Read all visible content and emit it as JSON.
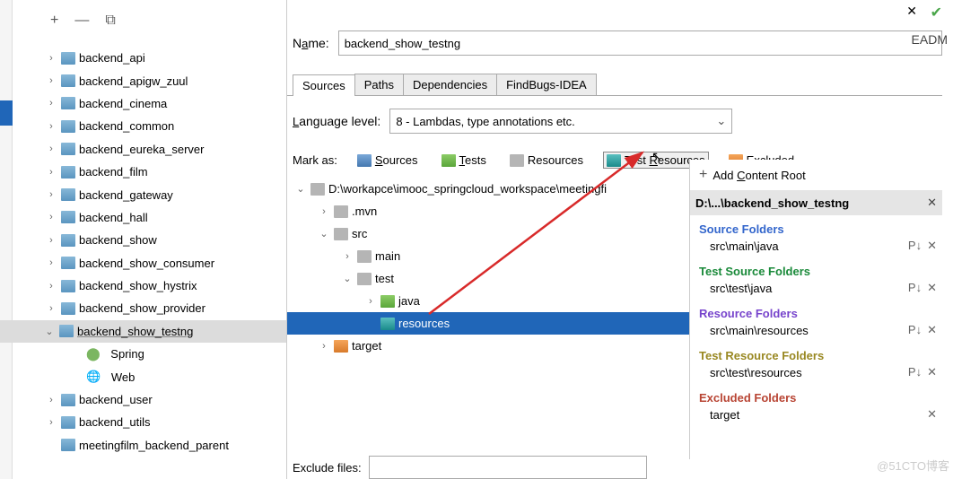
{
  "toolbar": {
    "add": "+",
    "remove": "—",
    "copy": "⧉"
  },
  "project_tree": [
    {
      "label": "backend_api"
    },
    {
      "label": "backend_apigw_zuul"
    },
    {
      "label": "backend_cinema"
    },
    {
      "label": "backend_common"
    },
    {
      "label": "backend_eureka_server"
    },
    {
      "label": "backend_film"
    },
    {
      "label": "backend_gateway"
    },
    {
      "label": "backend_hall"
    },
    {
      "label": "backend_show"
    },
    {
      "label": "backend_show_consumer"
    },
    {
      "label": "backend_show_hystrix"
    },
    {
      "label": "backend_show_provider"
    },
    {
      "label": "backend_show_testng",
      "selected": true
    },
    {
      "label": "Spring",
      "kind": "spring"
    },
    {
      "label": "Web",
      "kind": "web"
    },
    {
      "label": "backend_user"
    },
    {
      "label": "backend_utils"
    },
    {
      "label": "meetingfilm_backend_parent"
    }
  ],
  "form": {
    "name_label": "Name:",
    "name_value": "backend_show_testng",
    "tabs": [
      "Sources",
      "Paths",
      "Dependencies",
      "FindBugs-IDEA"
    ],
    "lang_label": "Language level:",
    "lang_value": "8 - Lambdas, type annotations etc.",
    "mark_label": "Mark as:",
    "marks": {
      "sources": "Sources",
      "tests": "Tests",
      "resources": "Resources",
      "test_resources": "Test Resources",
      "excluded": "Excluded"
    }
  },
  "file_tree": {
    "root": "D:\\workapce\\imooc_springcloud_workspace\\meetingfi",
    "mvn": ".mvn",
    "src": "src",
    "main": "main",
    "test": "test",
    "java": "java",
    "resources": "resources",
    "target": "target"
  },
  "side": {
    "add_root": "Add Content Root",
    "root_path": "D:\\...\\backend_show_testng",
    "source_title": "Source Folders",
    "source_path": "src\\main\\java",
    "tsource_title": "Test Source Folders",
    "tsource_path": "src\\test\\java",
    "res_title": "Resource Folders",
    "res_path": "src\\main\\resources",
    "tres_title": "Test Resource Folders",
    "tres_path": "src\\test\\resources",
    "exc_title": "Excluded Folders",
    "exc_path": "target",
    "p_badge": "P↓",
    "x": "✕"
  },
  "exclude_label": "Exclude files:",
  "readm": "EADM",
  "watermark": "@51CTO博客"
}
